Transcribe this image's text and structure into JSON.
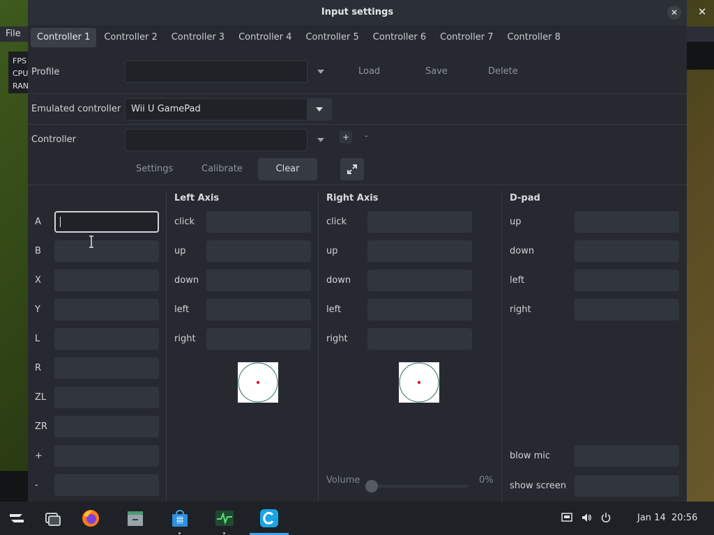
{
  "background": {
    "menu_file": "File",
    "stats_lines": [
      "FPS",
      "CPU",
      "RAN"
    ]
  },
  "dialog": {
    "title": "Input settings",
    "tabs": [
      "Controller 1",
      "Controller 2",
      "Controller 3",
      "Controller 4",
      "Controller 5",
      "Controller 6",
      "Controller 7",
      "Controller 8"
    ],
    "active_tab": "Controller 1"
  },
  "profile": {
    "label": "Profile",
    "value": "",
    "load": "Load",
    "save": "Save",
    "delete": "Delete"
  },
  "emulated": {
    "label": "Emulated controller",
    "value": "Wii U GamePad"
  },
  "controller": {
    "label": "Controller",
    "value": "",
    "add": "+",
    "remove": "-",
    "settings": "Settings",
    "calibrate": "Calibrate",
    "clear": "Clear"
  },
  "buttons": {
    "keys": [
      "A",
      "B",
      "X",
      "Y",
      "L",
      "R",
      "ZL",
      "ZR",
      "+",
      "-"
    ]
  },
  "left_axis": {
    "title": "Left Axis",
    "keys": [
      "click",
      "up",
      "down",
      "left",
      "right"
    ]
  },
  "right_axis": {
    "title": "Right Axis",
    "keys": [
      "click",
      "up",
      "down",
      "left",
      "right"
    ]
  },
  "dpad": {
    "title": "D-pad",
    "keys": [
      "up",
      "down",
      "left",
      "right"
    ],
    "extra_keys": [
      "blow mic",
      "show screen"
    ]
  },
  "volume": {
    "label": "Volume",
    "value_text": "0%",
    "level": 0
  },
  "taskbar": {
    "date": "Jan 14",
    "time": "20:56"
  },
  "colors": {
    "accent": "#3fa3e8",
    "axis_dot": "#d0021b"
  }
}
